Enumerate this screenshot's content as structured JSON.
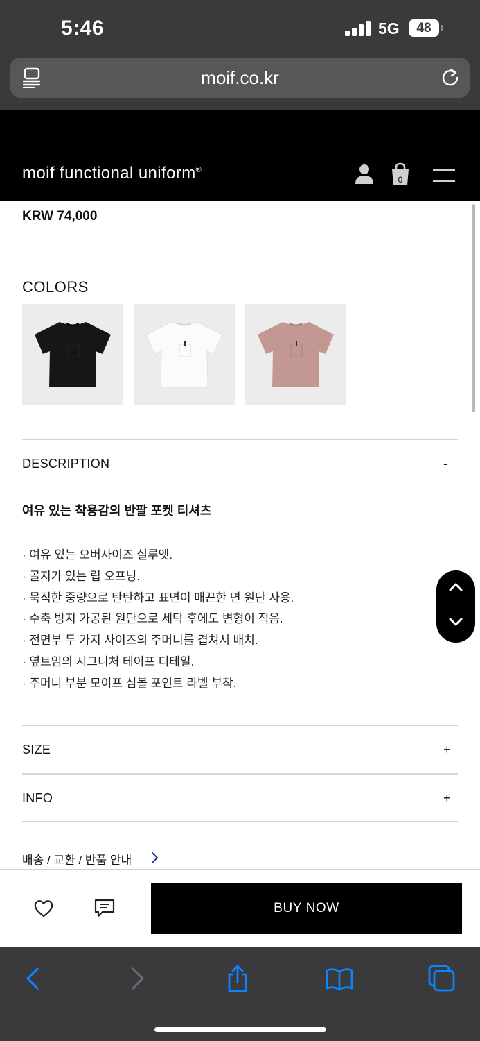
{
  "status_bar": {
    "time": "5:46",
    "network": "5G",
    "battery": "48"
  },
  "browser": {
    "url": "moif.co.kr"
  },
  "site": {
    "brand": "moif functional uniform",
    "brand_mark": "®",
    "cart_count": "0"
  },
  "product": {
    "price": "KRW 74,000",
    "colors_label": "COLORS",
    "colors": [
      {
        "name": "black",
        "hex": "#151618"
      },
      {
        "name": "white",
        "hex": "#fbfbfb"
      },
      {
        "name": "pink",
        "hex": "#c49892"
      }
    ]
  },
  "sections": {
    "description": {
      "title": "DESCRIPTION",
      "toggle": "-",
      "heading": "여유 있는 착용감의 반팔 포켓 티셔츠",
      "bullets": [
        "· 여유 있는 오버사이즈 실루엣.",
        "· 골지가 있는 립 오프닝.",
        "· 묵직한 중량으로 탄탄하고 표면이 매끈한 면 원단 사용.",
        "· 수축 방지 가공된 원단으로 세탁 후에도 변형이 적음.",
        "· 전면부 두 가지 사이즈의 주머니를 겹쳐서 배치.",
        "· 옆트임의 시그니처 테이프 디테일.",
        "· 주머니 부분 모이프 심볼 포인트 라벨 부착."
      ]
    },
    "size": {
      "title": "SIZE",
      "toggle": "+"
    },
    "info": {
      "title": "INFO",
      "toggle": "+"
    },
    "shipping": {
      "label": "배송 / 교환 / 반품 안내"
    }
  },
  "actions": {
    "buy_label": "BUY NOW"
  },
  "icons": [
    "reader-icon",
    "reload-icon",
    "user-icon",
    "shopping-bag-icon",
    "menu-icon",
    "chevron-right-icon",
    "chevron-up-icon",
    "chevron-down-icon",
    "heart-icon",
    "comment-icon",
    "back-icon",
    "forward-icon",
    "share-icon",
    "bookmarks-icon",
    "tabs-icon"
  ],
  "colors": {
    "dark_chrome": "#3a3a3c",
    "header_bg": "#000000",
    "accent_blue": "#0a84ff"
  }
}
